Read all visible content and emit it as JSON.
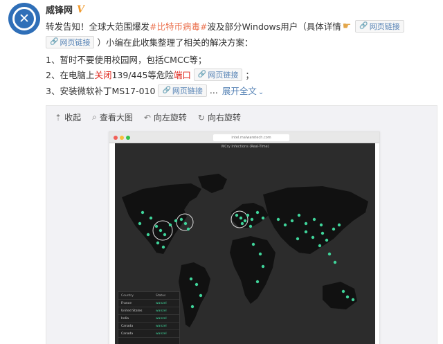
{
  "author": {
    "name": "威锋网",
    "verified_mark": "V"
  },
  "avatar": {
    "glyph": "✕"
  },
  "post": {
    "line1": {
      "a": "转发告知！全球大范围爆发",
      "tag": "#比特币病毒#",
      "b": "波及部分Windows用户（具体详情"
    },
    "line2": {
      "a": "）小编在此收集整理了相关的解决方案："
    },
    "line3": {
      "a": "1、暂时不要使用校园网，包括CMCC等；"
    },
    "line4": {
      "a": "2、在电脑上",
      "red1": "关闭",
      "b": "139/445等危险",
      "red2": "端口",
      "c": "；"
    },
    "line5": {
      "a": "3、安装微软补丁MS17-010",
      "ellipsis": "...",
      "expand": "展开全文"
    },
    "link_label": "网页链接"
  },
  "toolbar": {
    "collapse": "收起",
    "view_large": "查看大图",
    "rotate_left": "向左旋转",
    "rotate_right": "向右旋转"
  },
  "screenshot": {
    "url": "intel.malwaretech.com",
    "map_title": "WCry Infections (Real-Time)",
    "legend_headers": [
      "Country",
      "Status"
    ],
    "legend_rows": [
      [
        "France",
        "wanzel"
      ],
      [
        "United States",
        "wanzel"
      ],
      [
        "India",
        "wanzel"
      ],
      [
        "Canada",
        "wanzel"
      ],
      [
        "Canada",
        "wanzel"
      ]
    ]
  },
  "colors": {
    "link": "#5582b5",
    "hashtag": "#eb7350",
    "warning_red": "#e0241a",
    "infection_dot": "#3fd49a",
    "map_land": "#111111",
    "map_sea": "#2c2c2c"
  },
  "icons": [
    "hand-pointing-icon",
    "link-chain-icon",
    "collapse-arrow-icon",
    "magnifier-icon",
    "rotate-left-icon",
    "rotate-right-icon",
    "chevron-down-icon"
  ]
}
